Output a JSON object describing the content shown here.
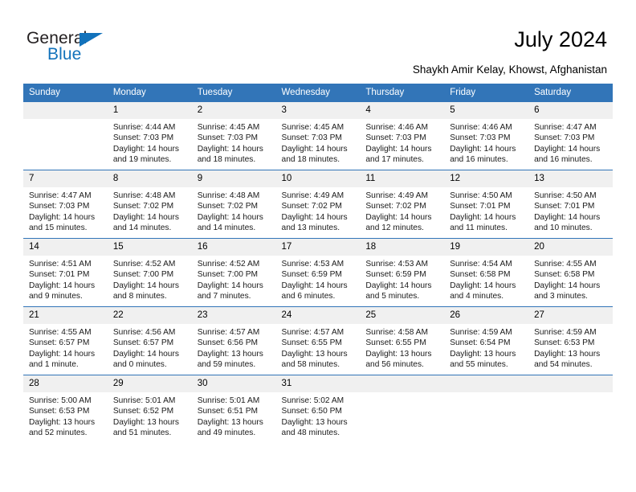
{
  "brand": {
    "name_part1": "General",
    "name_part2": "Blue",
    "triangle_icon": "triangle-icon",
    "accent_color": "#1272bb"
  },
  "header": {
    "title": "July 2024",
    "subtitle": "Shaykh Amir Kelay, Khowst, Afghanistan"
  },
  "theme": {
    "header_blue": "#3275b8",
    "daynum_band": "#f0f0f0",
    "text": "#000000"
  },
  "calendar": {
    "weekday_headers": [
      "Sunday",
      "Monday",
      "Tuesday",
      "Wednesday",
      "Thursday",
      "Friday",
      "Saturday"
    ],
    "weeks": [
      [
        {
          "day": "",
          "sunrise": "",
          "sunset": "",
          "daylight": "",
          "daylight2": ""
        },
        {
          "day": "1",
          "sunrise": "Sunrise: 4:44 AM",
          "sunset": "Sunset: 7:03 PM",
          "daylight": "Daylight: 14 hours",
          "daylight2": "and 19 minutes."
        },
        {
          "day": "2",
          "sunrise": "Sunrise: 4:45 AM",
          "sunset": "Sunset: 7:03 PM",
          "daylight": "Daylight: 14 hours",
          "daylight2": "and 18 minutes."
        },
        {
          "day": "3",
          "sunrise": "Sunrise: 4:45 AM",
          "sunset": "Sunset: 7:03 PM",
          "daylight": "Daylight: 14 hours",
          "daylight2": "and 18 minutes."
        },
        {
          "day": "4",
          "sunrise": "Sunrise: 4:46 AM",
          "sunset": "Sunset: 7:03 PM",
          "daylight": "Daylight: 14 hours",
          "daylight2": "and 17 minutes."
        },
        {
          "day": "5",
          "sunrise": "Sunrise: 4:46 AM",
          "sunset": "Sunset: 7:03 PM",
          "daylight": "Daylight: 14 hours",
          "daylight2": "and 16 minutes."
        },
        {
          "day": "6",
          "sunrise": "Sunrise: 4:47 AM",
          "sunset": "Sunset: 7:03 PM",
          "daylight": "Daylight: 14 hours",
          "daylight2": "and 16 minutes."
        }
      ],
      [
        {
          "day": "7",
          "sunrise": "Sunrise: 4:47 AM",
          "sunset": "Sunset: 7:03 PM",
          "daylight": "Daylight: 14 hours",
          "daylight2": "and 15 minutes."
        },
        {
          "day": "8",
          "sunrise": "Sunrise: 4:48 AM",
          "sunset": "Sunset: 7:02 PM",
          "daylight": "Daylight: 14 hours",
          "daylight2": "and 14 minutes."
        },
        {
          "day": "9",
          "sunrise": "Sunrise: 4:48 AM",
          "sunset": "Sunset: 7:02 PM",
          "daylight": "Daylight: 14 hours",
          "daylight2": "and 14 minutes."
        },
        {
          "day": "10",
          "sunrise": "Sunrise: 4:49 AM",
          "sunset": "Sunset: 7:02 PM",
          "daylight": "Daylight: 14 hours",
          "daylight2": "and 13 minutes."
        },
        {
          "day": "11",
          "sunrise": "Sunrise: 4:49 AM",
          "sunset": "Sunset: 7:02 PM",
          "daylight": "Daylight: 14 hours",
          "daylight2": "and 12 minutes."
        },
        {
          "day": "12",
          "sunrise": "Sunrise: 4:50 AM",
          "sunset": "Sunset: 7:01 PM",
          "daylight": "Daylight: 14 hours",
          "daylight2": "and 11 minutes."
        },
        {
          "day": "13",
          "sunrise": "Sunrise: 4:50 AM",
          "sunset": "Sunset: 7:01 PM",
          "daylight": "Daylight: 14 hours",
          "daylight2": "and 10 minutes."
        }
      ],
      [
        {
          "day": "14",
          "sunrise": "Sunrise: 4:51 AM",
          "sunset": "Sunset: 7:01 PM",
          "daylight": "Daylight: 14 hours",
          "daylight2": "and 9 minutes."
        },
        {
          "day": "15",
          "sunrise": "Sunrise: 4:52 AM",
          "sunset": "Sunset: 7:00 PM",
          "daylight": "Daylight: 14 hours",
          "daylight2": "and 8 minutes."
        },
        {
          "day": "16",
          "sunrise": "Sunrise: 4:52 AM",
          "sunset": "Sunset: 7:00 PM",
          "daylight": "Daylight: 14 hours",
          "daylight2": "and 7 minutes."
        },
        {
          "day": "17",
          "sunrise": "Sunrise: 4:53 AM",
          "sunset": "Sunset: 6:59 PM",
          "daylight": "Daylight: 14 hours",
          "daylight2": "and 6 minutes."
        },
        {
          "day": "18",
          "sunrise": "Sunrise: 4:53 AM",
          "sunset": "Sunset: 6:59 PM",
          "daylight": "Daylight: 14 hours",
          "daylight2": "and 5 minutes."
        },
        {
          "day": "19",
          "sunrise": "Sunrise: 4:54 AM",
          "sunset": "Sunset: 6:58 PM",
          "daylight": "Daylight: 14 hours",
          "daylight2": "and 4 minutes."
        },
        {
          "day": "20",
          "sunrise": "Sunrise: 4:55 AM",
          "sunset": "Sunset: 6:58 PM",
          "daylight": "Daylight: 14 hours",
          "daylight2": "and 3 minutes."
        }
      ],
      [
        {
          "day": "21",
          "sunrise": "Sunrise: 4:55 AM",
          "sunset": "Sunset: 6:57 PM",
          "daylight": "Daylight: 14 hours",
          "daylight2": "and 1 minute."
        },
        {
          "day": "22",
          "sunrise": "Sunrise: 4:56 AM",
          "sunset": "Sunset: 6:57 PM",
          "daylight": "Daylight: 14 hours",
          "daylight2": "and 0 minutes."
        },
        {
          "day": "23",
          "sunrise": "Sunrise: 4:57 AM",
          "sunset": "Sunset: 6:56 PM",
          "daylight": "Daylight: 13 hours",
          "daylight2": "and 59 minutes."
        },
        {
          "day": "24",
          "sunrise": "Sunrise: 4:57 AM",
          "sunset": "Sunset: 6:55 PM",
          "daylight": "Daylight: 13 hours",
          "daylight2": "and 58 minutes."
        },
        {
          "day": "25",
          "sunrise": "Sunrise: 4:58 AM",
          "sunset": "Sunset: 6:55 PM",
          "daylight": "Daylight: 13 hours",
          "daylight2": "and 56 minutes."
        },
        {
          "day": "26",
          "sunrise": "Sunrise: 4:59 AM",
          "sunset": "Sunset: 6:54 PM",
          "daylight": "Daylight: 13 hours",
          "daylight2": "and 55 minutes."
        },
        {
          "day": "27",
          "sunrise": "Sunrise: 4:59 AM",
          "sunset": "Sunset: 6:53 PM",
          "daylight": "Daylight: 13 hours",
          "daylight2": "and 54 minutes."
        }
      ],
      [
        {
          "day": "28",
          "sunrise": "Sunrise: 5:00 AM",
          "sunset": "Sunset: 6:53 PM",
          "daylight": "Daylight: 13 hours",
          "daylight2": "and 52 minutes."
        },
        {
          "day": "29",
          "sunrise": "Sunrise: 5:01 AM",
          "sunset": "Sunset: 6:52 PM",
          "daylight": "Daylight: 13 hours",
          "daylight2": "and 51 minutes."
        },
        {
          "day": "30",
          "sunrise": "Sunrise: 5:01 AM",
          "sunset": "Sunset: 6:51 PM",
          "daylight": "Daylight: 13 hours",
          "daylight2": "and 49 minutes."
        },
        {
          "day": "31",
          "sunrise": "Sunrise: 5:02 AM",
          "sunset": "Sunset: 6:50 PM",
          "daylight": "Daylight: 13 hours",
          "daylight2": "and 48 minutes."
        },
        {
          "day": "",
          "sunrise": "",
          "sunset": "",
          "daylight": "",
          "daylight2": ""
        },
        {
          "day": "",
          "sunrise": "",
          "sunset": "",
          "daylight": "",
          "daylight2": ""
        },
        {
          "day": "",
          "sunrise": "",
          "sunset": "",
          "daylight": "",
          "daylight2": ""
        }
      ]
    ]
  }
}
